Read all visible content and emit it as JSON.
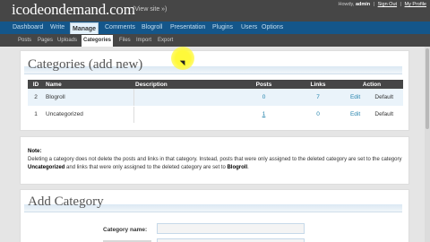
{
  "header": {
    "site_title": "icodeondemand.com",
    "view_site": "(View site »)",
    "greeting": "Howdy,",
    "username": "admin",
    "separator": "|",
    "sign_out": "Sign Out",
    "my_profile": "My Profile"
  },
  "main_nav": [
    "Dashboard",
    "Write",
    "Manage",
    "Comments",
    "Blogroll",
    "Presentation",
    "Plugins",
    "Users",
    "Options"
  ],
  "sub_nav": [
    "Posts",
    "Pages",
    "Uploads",
    "Categories",
    "Files",
    "Import",
    "Export"
  ],
  "categories": {
    "heading": "Categories",
    "add_new_link": "(add new)",
    "columns": [
      "ID",
      "Name",
      "Description",
      "Posts",
      "Links",
      "Action"
    ],
    "rows": [
      {
        "id": "2",
        "name": "Blogroll",
        "description": "",
        "posts": "0",
        "links": "7",
        "edit": "Edit",
        "action2": "Default"
      },
      {
        "id": "1",
        "name": "Uncategorized",
        "description": "",
        "posts": "1",
        "links": "0",
        "edit": "Edit",
        "action2": "Default"
      }
    ]
  },
  "note": {
    "title": "Note:",
    "text_1": "Deleting a category does not delete the posts and links in that category. Instead, posts that were only assigned to the deleted category are set to the category",
    "bold_1": "Uncategorized",
    "text_2": "and links that were only assigned to the deleted category are set to",
    "bold_2": "Blogroll",
    "text_3": "."
  },
  "add_category": {
    "heading": "Add Category",
    "name_label": "Category name:",
    "name_value": ""
  },
  "colors": {
    "header_bg": "#464646",
    "main_nav_bg": "#14568a",
    "link": "#2583ad",
    "highlight": "#fff93a"
  }
}
